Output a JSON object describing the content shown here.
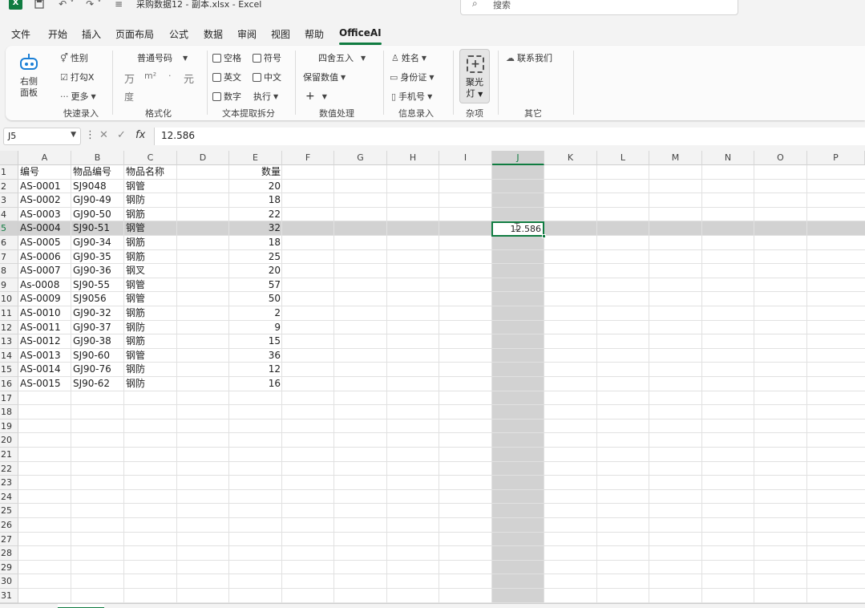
{
  "titlebar": {
    "app_icon": "X",
    "save_icon": "save-icon",
    "undo_icon": "undo-icon",
    "redo_icon": "redo-icon",
    "customize_icon": "customize-icon",
    "title": "采购数据12 - 副本.xlsx  -  Excel",
    "search_placeholder": "搜索"
  },
  "tabs": [
    "文件",
    "开始",
    "插入",
    "页面布局",
    "公式",
    "数据",
    "审阅",
    "视图",
    "帮助",
    "OfficeAI"
  ],
  "ribbon": {
    "robot_label_1": "右侧",
    "robot_label_2": "面板",
    "quick_entry": {
      "gender": "性别",
      "checkx": "打勾X",
      "more": "更多",
      "group_label": "快速录入"
    },
    "format": {
      "number_format": "普通号码",
      "wan": "万",
      "m2": "m²",
      "dot": "·",
      "yuan": "元",
      "du": "度",
      "group_label": "格式化"
    },
    "text_extract": {
      "space": "空格",
      "symbol": "符号",
      "english": "英文",
      "chinese": "中文",
      "digit": "数字",
      "execute": "执行",
      "group_label": "文本提取拆分"
    },
    "number_proc": {
      "round": "四舍五入",
      "keep_value": "保留数值",
      "plus": "+",
      "group_label": "数值处理"
    },
    "info_entry": {
      "name": "姓名",
      "idcard": "身份证",
      "phone": "手机号",
      "group_label": "信息录入"
    },
    "misc": {
      "spotlight_1": "聚光",
      "spotlight_2": "灯",
      "group_label": "杂项"
    },
    "other": {
      "contact": "联系我们",
      "group_label": "其它"
    }
  },
  "formula_bar": {
    "name_box": "J5",
    "cancel": "✕",
    "enter": "✓",
    "fx": "fx",
    "value": "12.586"
  },
  "columns": [
    "A",
    "B",
    "C",
    "D",
    "E",
    "F",
    "G",
    "H",
    "I",
    "J",
    "K",
    "L",
    "M",
    "N",
    "O",
    "P"
  ],
  "selected_column": "J",
  "selected_row": 5,
  "row_numbers": [
    "1",
    "2",
    "3",
    "4",
    "5",
    "6",
    "7",
    "8",
    "9",
    "10",
    "11",
    "12",
    "13",
    "14",
    "15",
    "16",
    "17",
    "18",
    "19",
    "20",
    "21",
    "22",
    "23",
    "24",
    "25",
    "26",
    "27",
    "28",
    "29",
    "30",
    "31"
  ],
  "header_row": {
    "a": "编号",
    "b": "物品编号",
    "c": "物品名称",
    "e": "数量"
  },
  "rows": [
    {
      "a": "AS-0001",
      "b": "SJ9048",
      "c": "钢管",
      "e": "20"
    },
    {
      "a": "AS-0002",
      "b": "GJ90-49",
      "c": "钢防",
      "e": "18"
    },
    {
      "a": "AS-0003",
      "b": "GJ90-50",
      "c": "钢筋",
      "e": "22"
    },
    {
      "a": "AS-0004",
      "b": "SJ90-51",
      "c": "钢管",
      "e": "32"
    },
    {
      "a": "AS-0005",
      "b": "GJ90-34",
      "c": "钢筋",
      "e": "18"
    },
    {
      "a": "AS-0006",
      "b": "GJ90-35",
      "c": "钢筋",
      "e": "25"
    },
    {
      "a": "AS-0007",
      "b": "GJ90-36",
      "c": "钢叉",
      "e": "20"
    },
    {
      "a": "As-0008",
      "b": "SJ90-55",
      "c": "钢管",
      "e": "57"
    },
    {
      "a": "AS-0009",
      "b": "SJ9056",
      "c": "钢管",
      "e": "50"
    },
    {
      "a": "AS-0010",
      "b": "GJ90-32",
      "c": "钢筋",
      "e": "2"
    },
    {
      "a": "AS-0011",
      "b": "GJ90-37",
      "c": "钢防",
      "e": "9"
    },
    {
      "a": "AS-0012",
      "b": "GJ90-38",
      "c": "钢筋",
      "e": "15"
    },
    {
      "a": "AS-0013",
      "b": "SJ90-60",
      "c": "钢管",
      "e": "36"
    },
    {
      "a": "AS-0014",
      "b": "GJ90-76",
      "c": "钢防",
      "e": "12"
    },
    {
      "a": "AS-0015",
      "b": "SJ90-62",
      "c": "钢防",
      "e": "16"
    }
  ],
  "active_cell_value": "12.586",
  "colors": {
    "accent": "#107c41",
    "selection": "#d2d2d2"
  }
}
